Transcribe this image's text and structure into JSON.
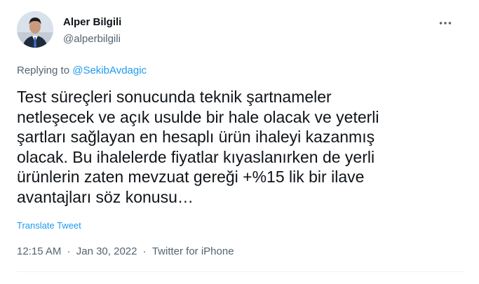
{
  "author": {
    "name": "Alper Bilgili",
    "handle": "@alperbilgili",
    "avatar_icon": "profile-photo"
  },
  "more_icon": "more-horizontal-icon",
  "reply": {
    "prefix": "Replying to",
    "mention": "@SekibAvdagic"
  },
  "tweet": {
    "lines": [
      "Test süreçleri sonucunda teknik şartnameler",
      "netleşecek ve açık usulde bir hale olacak ve yeterli",
      "şartları sağlayan en hesaplı ürün ihaleyi kazanmış",
      "olacak. Bu ihalelerde fiyatlar kıyaslanırken de yerli",
      "ürünlerin zaten mevzuat gereği +%15 lik bir ilave",
      "avantajları söz konusu…"
    ]
  },
  "translate_label": "Translate Tweet",
  "meta": {
    "time": "12:15 AM",
    "separator": "·",
    "date": "Jan 30, 2022",
    "source": "Twitter for iPhone"
  },
  "colors": {
    "text": "#0f1419",
    "secondary": "#536471",
    "link": "#1d9bf0",
    "divider": "#eff3f4"
  }
}
